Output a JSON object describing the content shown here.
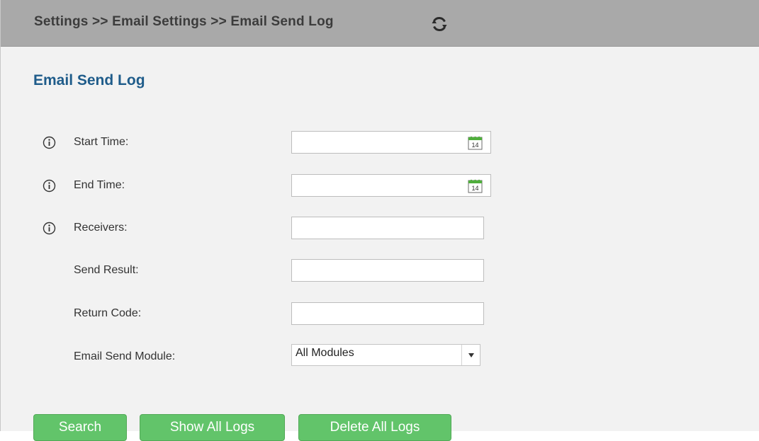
{
  "breadcrumb": {
    "text": "Settings >> Email Settings >> Email Send Log",
    "refresh_icon": "refresh-icon"
  },
  "page": {
    "title": "Email Send Log"
  },
  "form": {
    "start_time": {
      "label": "Start Time:",
      "value": "",
      "icon": "info-icon",
      "picker_icon": "calendar-icon",
      "picker_day": "14"
    },
    "end_time": {
      "label": "End Time:",
      "value": "",
      "icon": "info-icon",
      "picker_icon": "calendar-icon",
      "picker_day": "14"
    },
    "receivers": {
      "label": "Receivers:",
      "value": "",
      "icon": "info-icon"
    },
    "send_result": {
      "label": "Send Result:",
      "value": ""
    },
    "return_code": {
      "label": "Return Code:",
      "value": ""
    },
    "email_send_module": {
      "label": "Email Send Module:",
      "selected": "All Modules",
      "icon": "chevron-down-icon"
    }
  },
  "buttons": {
    "search": "Search",
    "show_all_logs": "Show All Logs",
    "delete_all_logs": "Delete All Logs"
  },
  "colors": {
    "breadcrumb_bar": "#a9a9a9",
    "title": "#1f5c8a",
    "button": "#62c46a",
    "background": "#f2f2f2"
  }
}
